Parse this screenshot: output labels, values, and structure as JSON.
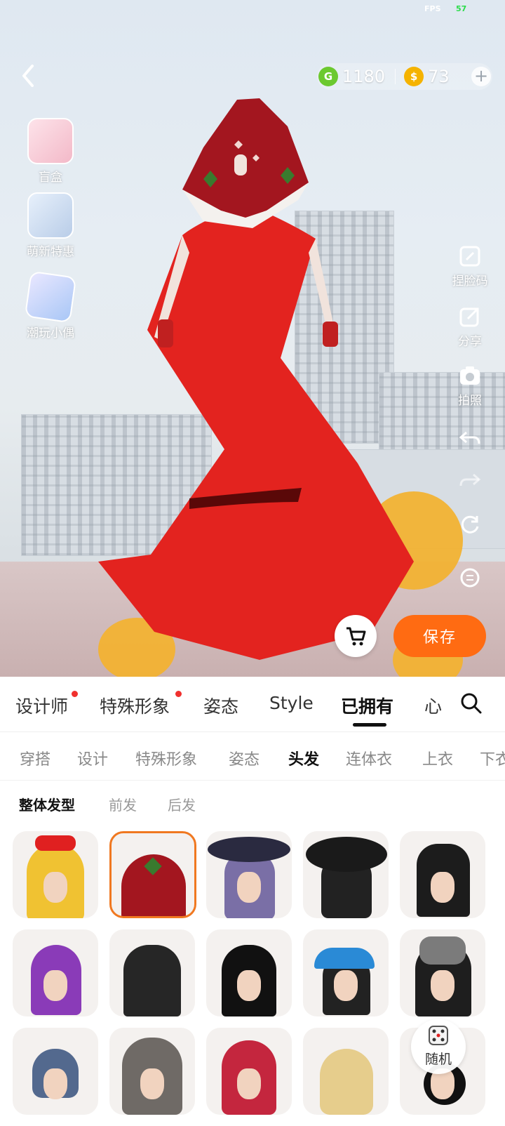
{
  "status": {
    "fps_label": "FPS",
    "fps_value": "57"
  },
  "header": {
    "currency_green": "1180",
    "currency_gold": "73",
    "green_symbol": "G",
    "gold_symbol": "$"
  },
  "left_menu": [
    {
      "label": "盲盒",
      "icon": "gift-box-icon"
    },
    {
      "label": "萌新特惠",
      "icon": "newbie-deal-icon"
    },
    {
      "label": "潮玩小偶",
      "icon": "figure-cube-icon"
    }
  ],
  "right_menu": [
    {
      "label": "捏脸码",
      "icon": "edit-code-icon"
    },
    {
      "label": "分享",
      "icon": "share-icon"
    },
    {
      "label": "拍照",
      "icon": "camera-icon"
    }
  ],
  "actions": {
    "save_label": "保存",
    "random_label": "随机"
  },
  "tabs_primary": [
    "设计师",
    "特殊形象",
    "姿态",
    "Style",
    "已拥有",
    "心"
  ],
  "tabs_primary_active": "已拥有",
  "tabs_secondary": [
    "穿搭",
    "设计",
    "特殊形象",
    "姿态",
    "头发",
    "连体衣",
    "上衣",
    "下衣"
  ],
  "tabs_secondary_active": "头发",
  "tabs_tertiary": [
    "整体发型",
    "前发",
    "后发"
  ],
  "tabs_tertiary_active": "整体发型",
  "colors": {
    "accent": "#ff6b12",
    "dress": "#e3231f",
    "badge": "#f0302e"
  }
}
